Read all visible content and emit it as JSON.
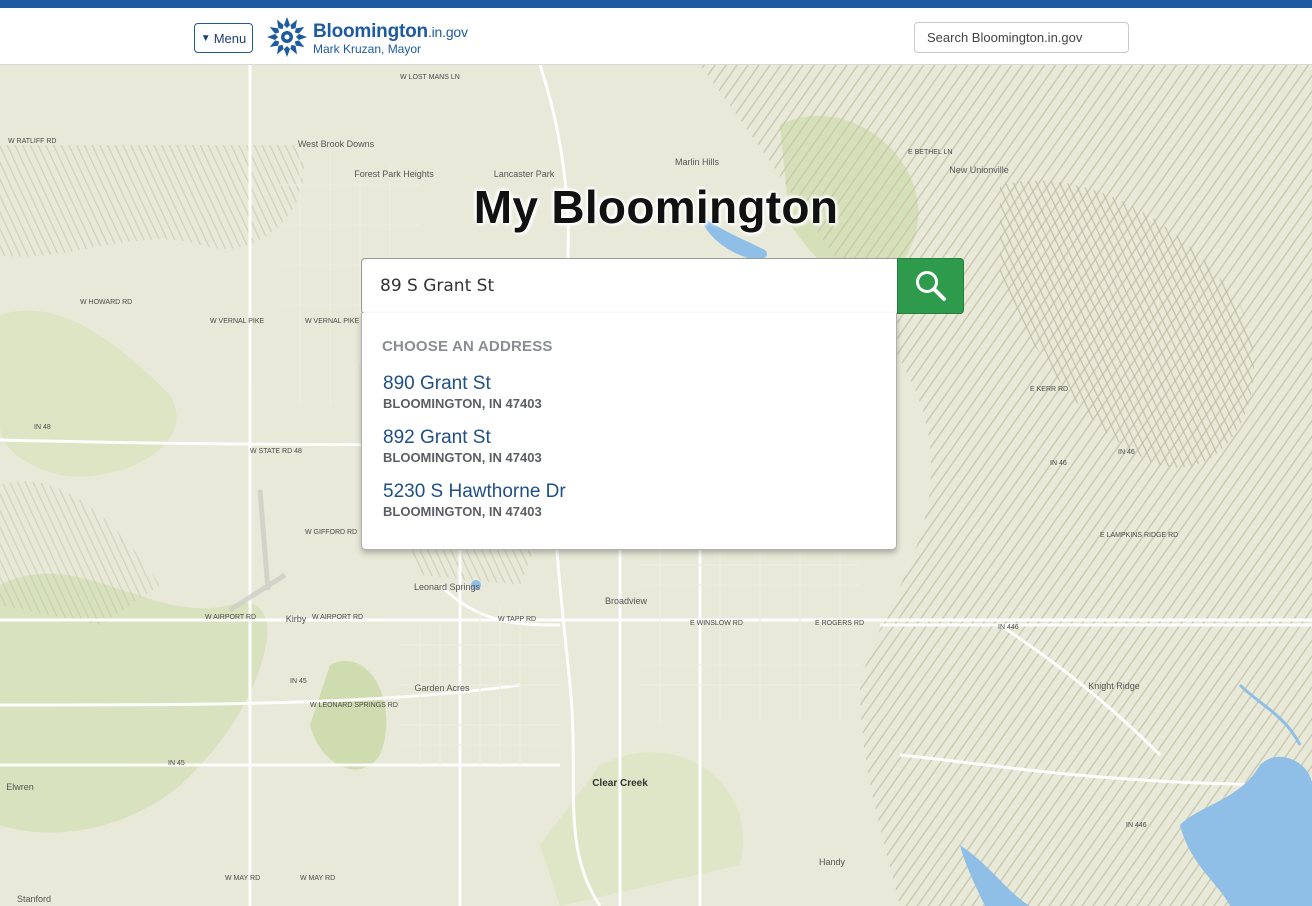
{
  "header": {
    "menu_label": "Menu",
    "menu_icon": "caret-down-icon",
    "logo_name": "Bloomington",
    "logo_suffix": ".in.gov",
    "logo_subtitle": "Mark Kruzan, Mayor",
    "search_placeholder": "Search Bloomington.in.gov"
  },
  "main": {
    "title": "My Bloomington",
    "address_value": "89 S Grant St",
    "search_icon": "magnifier-icon",
    "accent_color": "#2e9a4b",
    "brand_color": "#1e5aa0"
  },
  "dropdown": {
    "heading": "CHOOSE AN ADDRESS",
    "items": [
      {
        "street": "890 Grant St",
        "city": "BLOOMINGTON, IN 47403"
      },
      {
        "street": "892 Grant St",
        "city": "BLOOMINGTON, IN 47403"
      },
      {
        "street": "5230 S Hawthorne Dr",
        "city": "BLOOMINGTON, IN 47403"
      }
    ]
  },
  "map": {
    "labels": {
      "w_ratliff_rd": "W RATLIFF RD",
      "w_howard_rd": "W HOWARD RD",
      "w_vernal_pike": "W VERNAL PIKE",
      "w_state_rd_48": "W STATE RD 48",
      "in_48": "IN 48",
      "w_gifford_rd": "W GIFFORD RD",
      "w_airport_rd": "W AIRPORT RD",
      "w_tapp_rd": "W TAPP RD",
      "e_winslow_rd": "E WINSLOW RD",
      "e_rogers_rd": "E ROGERS RD",
      "in_446": "IN 446",
      "in_45": "IN 45",
      "w_leonard_springs_rd": "W LEONARD SPRINGS RD",
      "w_may_rd": "W MAY RD",
      "e_bethel_ln": "E BETHEL LN",
      "e_kerr_rd": "E KERR RD",
      "e_lampkins_ridge_rd": "E LAMPKINS RIDGE RD",
      "in_46": "IN 46",
      "w_lost_mans_ln": "W LOST MANS LN",
      "lancaster_park": "Lancaster Park",
      "west_brook_downs": "West Brook Downs",
      "forest_park_heights": "Forest Park Heights",
      "marlin_hills": "Marlin Hills",
      "new_unionville": "New Unionville",
      "leonard_springs": "Leonard Springs",
      "broadview": "Broadview",
      "kirby": "Kirby",
      "garden_acres": "Garden Acres",
      "clear_creek": "Clear Creek",
      "handy": "Handy",
      "knight_ridge": "Knight Ridge",
      "elwren": "Elwren",
      "stanford": "Stanford"
    }
  }
}
